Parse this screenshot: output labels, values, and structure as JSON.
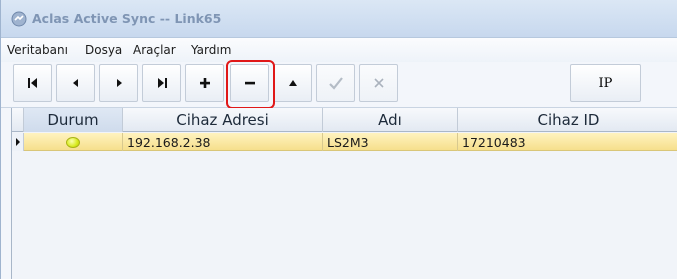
{
  "window": {
    "title": "Aclas Active Sync -- Link65"
  },
  "menu": {
    "items": [
      {
        "label": "Veritabanı"
      },
      {
        "label": "Dosya"
      },
      {
        "label": "Araçlar"
      },
      {
        "label": "Yardım"
      }
    ]
  },
  "toolbar": {
    "buttons": [
      {
        "name": "first-record",
        "icon": "first-icon",
        "enabled": true
      },
      {
        "name": "prior-record",
        "icon": "prior-icon",
        "enabled": true
      },
      {
        "name": "next-record",
        "icon": "next-icon",
        "enabled": true
      },
      {
        "name": "last-record",
        "icon": "last-icon",
        "enabled": true
      },
      {
        "name": "insert-record",
        "icon": "plus-icon",
        "enabled": true
      },
      {
        "name": "delete-record",
        "icon": "minus-icon",
        "enabled": true,
        "highlighted": true
      },
      {
        "name": "edit-record",
        "icon": "up-triangle-icon",
        "enabled": true
      },
      {
        "name": "post-record",
        "icon": "check-icon",
        "enabled": false
      },
      {
        "name": "cancel-record",
        "icon": "x-icon",
        "enabled": false
      }
    ],
    "ip_label": "IP"
  },
  "grid": {
    "columns": [
      "Durum",
      "Cihaz Adresi",
      "Adı",
      "Cihaz ID"
    ],
    "rows": [
      {
        "durum": "online",
        "cihaz_adresi": "192.168.2.38",
        "adi": "LS2M3",
        "cihaz_id": "17210483"
      }
    ]
  },
  "colors": {
    "highlight": "#e01818",
    "selected_row": "#f6df8c",
    "status_online": "#d8ea1e"
  }
}
